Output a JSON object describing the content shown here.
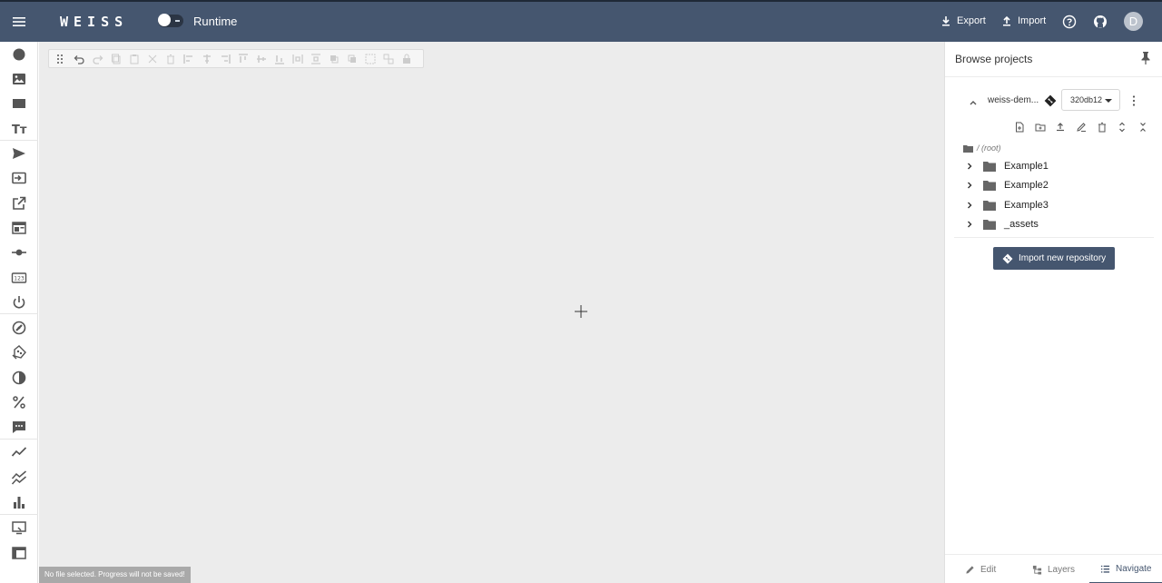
{
  "header": {
    "logo": "WEISS",
    "mode_label": "Runtime",
    "export_label": "Export",
    "import_label": "Import",
    "avatar_initial": "D"
  },
  "canvas": {
    "status_text": "No file selected. Progress will not be saved!"
  },
  "panel": {
    "title": "Browse projects",
    "repo_name": "weiss-dem...",
    "commit": "320db12",
    "root_label": "/ (root)",
    "tree": [
      {
        "label": "Example1"
      },
      {
        "label": "Example2"
      },
      {
        "label": "Example3"
      },
      {
        "label": "_assets"
      }
    ],
    "import_repo_label": "Import new repository",
    "tabs": [
      {
        "label": "Edit"
      },
      {
        "label": "Layers"
      },
      {
        "label": "Navigate"
      }
    ],
    "active_tab": "Navigate"
  },
  "colors": {
    "header_bg": "#45566f",
    "canvas_bg": "#ececec",
    "accent": "#45566f"
  }
}
